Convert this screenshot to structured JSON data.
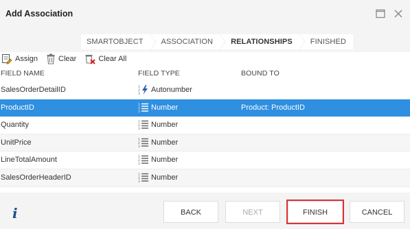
{
  "window": {
    "title": "Add Association"
  },
  "wizard": {
    "steps": [
      {
        "label": "SMARTOBJECT",
        "active": false
      },
      {
        "label": "ASSOCIATION",
        "active": false
      },
      {
        "label": "RELATIONSHIPS",
        "active": true
      },
      {
        "label": "FINISHED",
        "active": false
      }
    ]
  },
  "toolbar": {
    "assign": "Assign",
    "clear": "Clear",
    "clear_all": "Clear All"
  },
  "table": {
    "columns": [
      "FIELD NAME",
      "FIELD TYPE",
      "BOUND TO"
    ],
    "rows": [
      {
        "field_name": "SalesOrderDetailID",
        "field_type": "Autonumber",
        "bound_to": "",
        "icon": "autonumber-icon",
        "selected": false
      },
      {
        "field_name": "ProductID",
        "field_type": "Number",
        "bound_to": "Product: ProductID",
        "icon": "number-icon",
        "selected": true
      },
      {
        "field_name": "Quantity",
        "field_type": "Number",
        "bound_to": "",
        "icon": "number-icon",
        "selected": false
      },
      {
        "field_name": "UnitPrice",
        "field_type": "Number",
        "bound_to": "",
        "icon": "number-icon",
        "selected": false
      },
      {
        "field_name": "LineTotalAmount",
        "field_type": "Number",
        "bound_to": "",
        "icon": "number-icon",
        "selected": false
      },
      {
        "field_name": "SalesOrderHeaderID",
        "field_type": "Number",
        "bound_to": "",
        "icon": "number-icon",
        "selected": false
      }
    ]
  },
  "footer": {
    "info_glyph": "i",
    "back": "BACK",
    "next": "NEXT",
    "finish": "FINISH",
    "cancel": "CANCEL"
  },
  "colors": {
    "selected_row": "#2f8fe0",
    "highlight": "#e03030",
    "info": "#1a4f8a"
  }
}
